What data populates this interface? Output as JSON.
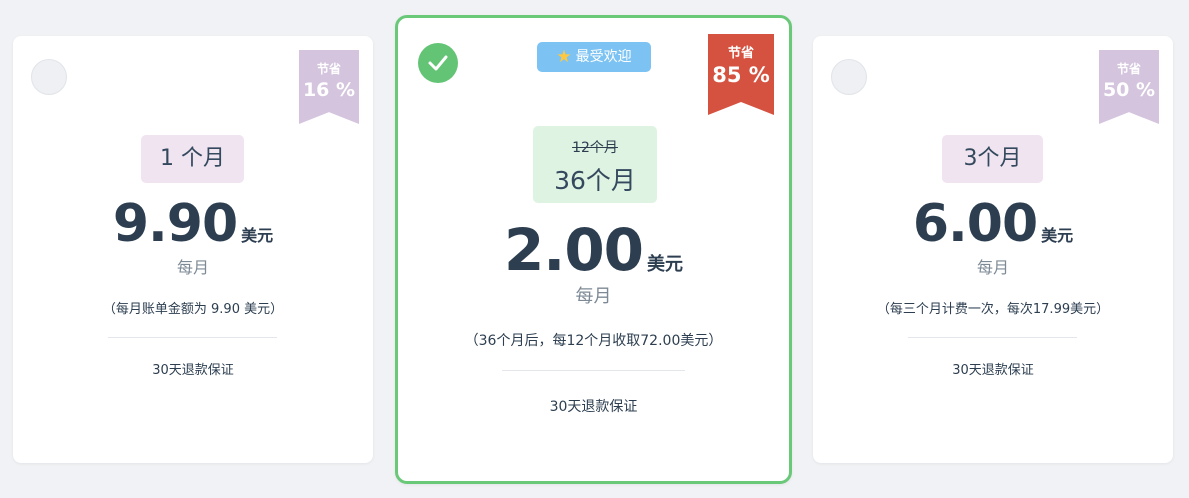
{
  "plans": [
    {
      "savings_label": "节省",
      "savings_pct": "16 %",
      "period": "1 个月",
      "price": "9.90",
      "currency": "美元",
      "per_month": "每月",
      "billing": "（每月账单金额为 9.90 美元）",
      "guarantee": "30天退款保证",
      "selected": false
    },
    {
      "badge": "最受欢迎",
      "savings_label": "节省",
      "savings_pct": "85 %",
      "period_old": "12个月",
      "period": "36个月",
      "price": "2.00",
      "currency": "美元",
      "per_month": "每月",
      "billing": "（36个月后，每12个月收取72.00美元）",
      "guarantee": "30天退款保证",
      "selected": true
    },
    {
      "savings_label": "节省",
      "savings_pct": "50 %",
      "period": "3个月",
      "price": "6.00",
      "currency": "美元",
      "per_month": "每月",
      "billing": "（每三个月计费一次，每次17.99美元）",
      "guarantee": "30天退款保证",
      "selected": false
    }
  ],
  "colors": {
    "selected_border": "#6ac879",
    "check_bg": "#62c474",
    "ribbon_default": "#d4c4de",
    "ribbon_highlight": "#d65240",
    "badge_bg": "#7cc3f3",
    "period_bg": "#efe4f0",
    "period_highlight_bg": "#def3e2",
    "price_text": "#2c3e50"
  },
  "icons": {
    "check": "check-icon",
    "star": "star-icon"
  }
}
